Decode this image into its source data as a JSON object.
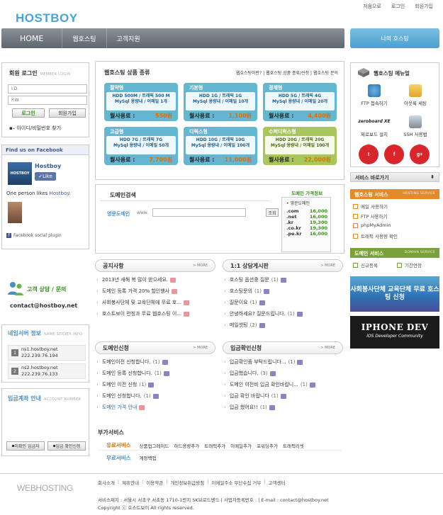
{
  "header": {
    "logo": "HOSTBOY",
    "top_links": [
      "처음으로",
      "로그인",
      "회원가입"
    ],
    "nav": [
      "HOME",
      "웹호스팅",
      "고객지원"
    ],
    "my_hosting": "나의 호스팅"
  },
  "login": {
    "title": "회원 로그인",
    "ghost": "MEMBER LOGIN",
    "id_placeholder": "I.D.",
    "pw_placeholder": "P.W.",
    "login_btn": "로그인",
    "join_btn": "회원가입",
    "find": "아이디/비밀번호 찾기"
  },
  "facebook": {
    "title": "Find us on Facebook",
    "page_name": "Hostboy",
    "thumb_text": "HOSTBOY",
    "like": "Like",
    "likes_prefix": "One person likes ",
    "likes_name": "Hostboy.",
    "plugin": "Facebook social plugin"
  },
  "contact": {
    "title": "고객 상담 / 문의",
    "email": "contact@hostboy.net"
  },
  "nameserver": {
    "title": "네임서버 정보",
    "ghost": "NAME SERVER INFO",
    "servers": [
      {
        "num": "1",
        "host": "ns1.hostboy.net",
        "ip": "222.239.76.194"
      },
      {
        "num": "2",
        "host": "ns2.hostboy.net",
        "ip": "222.239.76.133"
      }
    ]
  },
  "bank": {
    "title": "입금계좌 안내",
    "ghost": "ACCOUNT NUMBER",
    "btn1": "미확인 입금자",
    "btn2": "입금 확인신청"
  },
  "hosting": {
    "title": "웹호스팅 상품 종류",
    "links": "웹호스팅이란? | 웹호스팅 상품 종류/신청 | 웹호스팅 문의",
    "price_label": "월사용료 :",
    "plans": [
      {
        "name": "절약형",
        "l1": "HDD 500M / 트래픽 500 M",
        "l2": "MySql 용량내 / 이메일 1개",
        "price": "550원"
      },
      {
        "name": "기본형",
        "l1": "HDD 1G / 트래픽 1G",
        "l2": "MySql 용량내 / 이메일 10개",
        "price": "1,100원"
      },
      {
        "name": "경제형",
        "l1": "HDD 5G / 트래픽 4G",
        "l2": "MySql 용량내 / 이메일 20개",
        "price": "4,400원"
      },
      {
        "name": "고급형",
        "l1": "HDD 7G / 트래픽 7G",
        "l2": "MySql 용량내 / 이메일 50개",
        "price": "7,700원"
      },
      {
        "name": "디럭스형",
        "l1": "HDD 10G / 트래픽 10G",
        "l2": "MySql 용량내 / 이메일 100개",
        "price": "11,000원"
      },
      {
        "name": "수퍼디럭스형",
        "l1": "HDD 20G / 트래픽 20G",
        "l2": "MySql 용량내 / 이메일 100개",
        "price": "22,000원"
      }
    ]
  },
  "domain": {
    "title": "도메인검색",
    "label": "영문도메인",
    "www": "www.",
    "search_btn": "조회",
    "price_title": "도메인 가격정보",
    "price_header": "• 영문도메인",
    "prices": [
      {
        "ext": ".com",
        "price": "16,000"
      },
      {
        "ext": ".net",
        "price": "16,000"
      },
      {
        "ext": ".kr",
        "price": "19,300"
      },
      {
        "ext": ".co.kr",
        "price": "19,300"
      },
      {
        "ext": ".pe.kr",
        "price": "16,000"
      }
    ]
  },
  "boards": {
    "more": "> MORE",
    "notice": {
      "title": "공지사항",
      "items": [
        {
          "t": "2013년 새해 복 많이 받으세요.",
          "c": "",
          "tag": "r"
        },
        {
          "t": "도메인 등록 가격 20% 할인행사",
          "c": "",
          "tag": "r"
        },
        {
          "t": "사회봉사단체 및 교육단체에 무료 호...",
          "c": "",
          "tag": "r"
        },
        {
          "t": "호스트보이 런칭과 무료 웹호스팅 이...",
          "c": "",
          "tag": "r"
        }
      ]
    },
    "qna": {
      "title": "1:1 상담게시판",
      "items": [
        {
          "t": "호스팅 옵션중 질문",
          "c": "(1)",
          "tag": "p"
        },
        {
          "t": "호스팅문의",
          "c": "(1)",
          "tag": "p"
        },
        {
          "t": "질문이요",
          "c": "(1)",
          "tag": "p"
        },
        {
          "t": "안녕하세요? 질문드립니다.",
          "c": "(1)",
          "tag": "p"
        },
        {
          "t": "메일셋팅",
          "c": "(2)",
          "tag": "p"
        }
      ]
    },
    "domain_req": {
      "title": "도메인신청",
      "items": [
        {
          "t": "도메인이전 신청합니다.",
          "c": "(1)",
          "tag": "p"
        },
        {
          "t": "도메인 등록 신청합니다.",
          "c": "(1)",
          "tag": "p"
        },
        {
          "t": "도메인 이전 신청",
          "c": "(1)",
          "tag": "p"
        },
        {
          "t": "도메인 신청합니다.",
          "c": "(1)",
          "tag": "p"
        },
        {
          "t": "도메인 가격 안내",
          "c": "",
          "tag": "r",
          "hl": true
        }
      ]
    },
    "deposit": {
      "title": "입금확인신청",
      "items": [
        {
          "t": "입금확인좀 부탁드립니다...",
          "c": "(1)",
          "tag": "p"
        },
        {
          "t": "입금했습니다.",
          "c": "(3)",
          "tag": "p"
        },
        {
          "t": "도메인 이전비 입금 확인바랍니...",
          "c": "(1)",
          "tag": "p"
        },
        {
          "t": "입금 확인 바랍니다",
          "c": "(1)",
          "tag": "p"
        },
        {
          "t": "입금 했어요!!",
          "c": "(1)",
          "tag": "p"
        }
      ]
    }
  },
  "extra": {
    "title": "부가서비스",
    "paid_label": "유료서비스",
    "paid": [
      "상품업그레이드",
      "하드용량추가",
      "트래픽추가",
      "이메일추가",
      "포워딩추가",
      "트래픽리셋"
    ],
    "free_label": "무료서비스",
    "free": [
      "계정백업"
    ]
  },
  "right": {
    "menu_title": "웹호스팅 메뉴얼",
    "icons": [
      "FTP 접속하기",
      "아웃룩 세팅",
      "제로보드 설치",
      "SSH 사용법"
    ],
    "zeroboard": "zeroboard XE",
    "social": [
      "t",
      "f",
      "g+"
    ],
    "svc_shortcut": "서비스 바로가기",
    "web_sec": "웹호스팅 서비스",
    "web_ghost": "HOSTING SERVICE",
    "web_items": [
      "메일 사용하기",
      "FTP 사용하기",
      "phpMyAdmin",
      "트래픽 사용량 확인"
    ],
    "dom_sec": "도메인 서비스",
    "dom_ghost": "DOMAIN SERVICE",
    "dom_items": [
      "신규등록",
      "기간연장"
    ],
    "banner1": "사회봉사단체 교육단체 무료 호스팅 신청",
    "banner2_a": "IPHONE DEV",
    "banner2_b": "iOS Developer Community"
  },
  "footer": {
    "logo": "WEBHOSTING",
    "links": [
      "회사소개",
      "제휴안내",
      "이용약관",
      "개인정보취급방침",
      "이메일주소 무단수집 거부",
      "고객센터"
    ],
    "address": "서비스제지 : 서울시 서초구 서초동 1710-1번지 SK브로드밴드 | 사업자등록번호 :                                           | E-mail : contact@hostboy.net",
    "copyright": "Copyright ⓒ 호스트보이 All rights reserved."
  },
  "colors": {
    "accent": "#4aa3d8",
    "green": "#3a8f1e",
    "orange": "#e48a2b"
  }
}
